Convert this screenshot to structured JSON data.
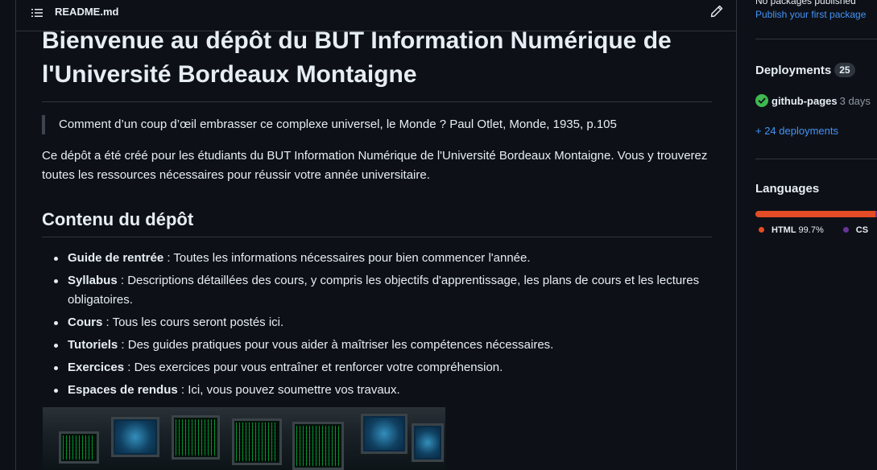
{
  "readme": {
    "title": "README.md",
    "heading": "Bienvenue au dépôt du BUT Information Numérique de l'Université Bordeaux Montaigne",
    "quote": "Comment d’un coup d’œil embrasser ce complexe universel, le Monde ? Paul Otlet, Monde, 1935, p.105",
    "intro": "Ce dépôt a été créé pour les étudiants du BUT Information Numérique de l'Université Bordeaux Montaigne. Vous y trouverez toutes les ressources nécessaires pour réussir votre année universitaire.",
    "section_heading": "Contenu du dépôt",
    "items": [
      {
        "term": "Guide de rentrée",
        "desc": " : Toutes les informations nécessaires pour bien commencer l'année."
      },
      {
        "term": "Syllabus",
        "desc": " : Descriptions détaillées des cours, y compris les objectifs d'apprentissage, les plans de cours et les lectures obligatoires."
      },
      {
        "term": "Cours",
        "desc": " : Tous les cours seront postés ici."
      },
      {
        "term": "Tutoriels",
        "desc": " : Des guides pratiques pour vous aider à maîtriser les compétences nécessaires."
      },
      {
        "term": "Exercices",
        "desc": " : Des exercices pour vous entraîner et renforcer votre compréhension."
      },
      {
        "term": "Espaces de rendus",
        "desc": " : Ici, vous pouvez soumettre vos travaux."
      }
    ]
  },
  "sidebar": {
    "packages_text": "No packages published",
    "publish_link": "Publish your first package",
    "deployments": {
      "heading": "Deployments",
      "count": "25",
      "latest_name": "github-pages",
      "latest_time": "3 days",
      "more_link": "+ 24 deployments"
    },
    "languages": {
      "heading": "Languages",
      "items": [
        {
          "name": "HTML",
          "percent": "99.7%",
          "color": "#e34c26",
          "share": 0.997
        },
        {
          "name": "CS",
          "percent": "",
          "color": "#663399",
          "share": 0.003
        }
      ]
    }
  },
  "colors": {
    "background": "#0d1117",
    "border": "#30363d",
    "link": "#4493f8",
    "success": "#3fb950"
  }
}
